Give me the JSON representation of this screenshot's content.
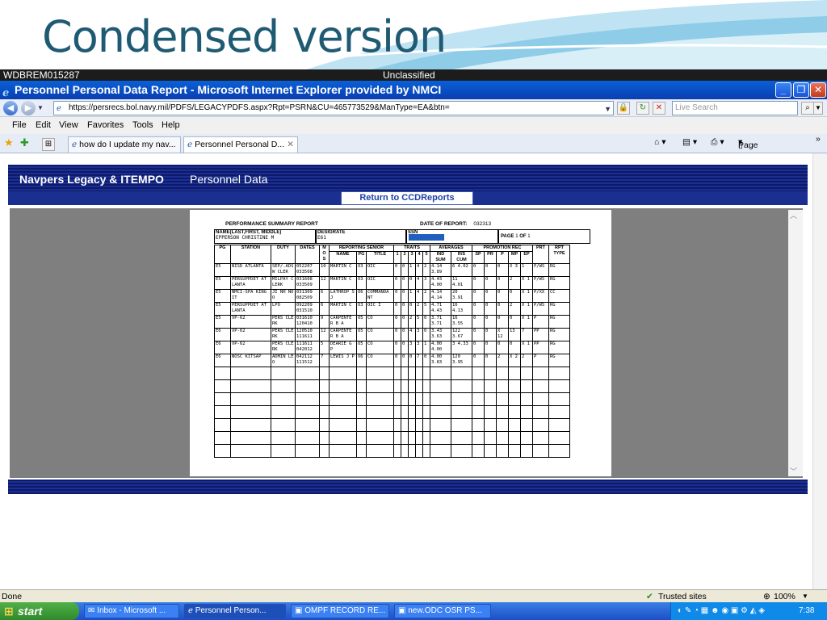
{
  "slide": {
    "title": "Condensed version"
  },
  "citrix": {
    "left": "WDBREM015287",
    "center": "Unclassified"
  },
  "window": {
    "title": "Personnel Personal Data Report - Microsoft Internet Explorer provided by NMCI"
  },
  "address": {
    "url": "https://persrecs.bol.navy.mil/PDFS/LEGACYPDFS.aspx?Rpt=PSRN&CU=465773529&ManType=EA&btn=",
    "search_placeholder": "Live Search"
  },
  "menu": [
    "File",
    "Edit",
    "View",
    "Favorites",
    "Tools",
    "Help"
  ],
  "tabs": [
    "how do I update my nav...",
    "Personnel Personal D..."
  ],
  "toolbar": {
    "page_label": "Page"
  },
  "portal": {
    "brand": "Navpers Legacy & ITEMPO",
    "section": "Personnel Data",
    "return_label": "Return to CCDReports"
  },
  "report": {
    "title": "PERFORMANCE SUMMARY REPORT",
    "date_label": "DATE OF REPORT:",
    "date_value": "032313",
    "name_label": "NAME(LAST,FIRST, MIDDLE)",
    "name_value": "EPPERSON CHRISTINE M",
    "desig_label": "DESIGRATE",
    "desig_value": "E61",
    "ssn_label": "SSN",
    "page_label": "PAGE",
    "page_num": "1",
    "of_label": "OF",
    "page_total": "1",
    "headers": {
      "pg": "PG",
      "station": "STATION",
      "duty": "DUTY",
      "dates": "DATES",
      "mos": "M O S",
      "reporting_senior": "REPORTING SENIOR",
      "rs_name": "NAME",
      "rs_pg": "PG",
      "rs_title": "TITLE",
      "traits": "TRAITS",
      "t1": "1",
      "t2": "2",
      "t3": "3",
      "t4": "4",
      "t5": "5",
      "averages": "AVERAGES",
      "ind_sum": "IND SUM",
      "rs_cum": "R/S CUM",
      "promotion_rec": "PROMOTION REC",
      "sp": "SP",
      "pr": "PR",
      "p": "P",
      "mp": "MP",
      "ep": "EP",
      "prt": "PRT",
      "rpt_type": "RPT TYPE"
    },
    "rows": [
      {
        "pg": "E5",
        "station": "NISD ATLANTA",
        "duty": "SEP/.ADS W CLER",
        "dates": "052207 033508",
        "mos": "10",
        "rs_name": "MARTIN C",
        "rs_pg": "O3",
        "rs_title": "OIC",
        "t1": "0",
        "t2": "0",
        "t3": "1",
        "t4": "4",
        "t5": "2",
        "ind": "4.14 3.89",
        "cum": "6 4.02",
        "sp": "0",
        "pr": "0",
        "p": "0",
        "mp": "X 3",
        "ep": "1",
        "prt": "P/WS",
        "type": "RG"
      },
      {
        "pg": "E5",
        "station": "PERSUPPDET AT LANTA",
        "duty": "MILPAY C LERK",
        "dates": "031608 033509",
        "mos": "12",
        "rs_name": "MARTIN C",
        "rs_pg": "O3",
        "rs_title": "OIC",
        "t1": "0",
        "t2": "0",
        "t3": "0",
        "t4": "4",
        "t5": "3",
        "ind": "4.43 4.00",
        "cum": "11 4.01",
        "sp": "0",
        "pr": "0",
        "p": "0",
        "mp": "2",
        "ep": "X 1",
        "prt": "P/WS",
        "type": "RG"
      },
      {
        "pg": "E5",
        "station": "NMCI-SPA KING IT",
        "duty": "JI NH NO O",
        "dates": "031309 082509",
        "mos": "6",
        "rs_name": "LATHROP S J",
        "rs_pg": "O6",
        "rs_title": "COMMANDA NT",
        "t1": "0",
        "t2": "0",
        "t3": "1",
        "t4": "4",
        "t5": "2",
        "ind": "4.14 4.14",
        "cum": "20 3.91",
        "sp": "0",
        "pr": "0",
        "p": "0",
        "mp": "0",
        "ep": "X 1",
        "prt": "P/XX",
        "type": "CC"
      },
      {
        "pg": "E5",
        "station": "PERSUPPDET AT LANTA",
        "duty": "LPO",
        "dates": "092209 031510",
        "mos": "6",
        "rs_name": "MARTIN C",
        "rs_pg": "O3",
        "rs_title": "OIC I",
        "t1": "0",
        "t2": "0",
        "t3": "0",
        "t4": "2",
        "t5": "5",
        "ind": "4.71 4.43",
        "cum": "16 4.13",
        "sp": "0",
        "pr": "0",
        "p": "0",
        "mp": "2",
        "ep": "X 1",
        "prt": "P/WS",
        "type": "RG"
      },
      {
        "pg": "E5",
        "station": "VP-62",
        "duty": "PERS CLE RK",
        "dates": "031610 120410",
        "mos": "9",
        "rs_name": "CARPENTE R B A",
        "rs_pg": "O5",
        "rs_title": "CO",
        "t1": "0",
        "t2": "0",
        "t3": "2",
        "t4": "5",
        "t5": "0",
        "ind": "3.71 3.71",
        "cum": "16 3.55",
        "sp": "0",
        "pr": "0",
        "p": "0",
        "mp": "0",
        "ep": "X 1",
        "prt": "P",
        "type": "RG"
      },
      {
        "pg": "E6",
        "station": "VP-62",
        "duty": "PERS CLE RK",
        "dates": "120510 111611",
        "mos": "12",
        "rs_name": "CARPENTE R B A",
        "rs_pg": "O5",
        "rs_title": "CO",
        "t1": "0",
        "t2": "0",
        "t3": "4",
        "t4": "3",
        "t5": "0",
        "ind": "3.43 3.63",
        "cum": "122 3.67",
        "sp": "0",
        "pr": "0",
        "p": "X 12",
        "mp": "13",
        "ep": "7",
        "prt": "PP",
        "type": "RG"
      },
      {
        "pg": "E6",
        "station": "VP-62",
        "duty": "PERS CLE RK",
        "dates": "111611 042012",
        "mos": "5",
        "rs_name": "DEARIE G P",
        "rs_pg": "O5",
        "rs_title": "CO",
        "t1": "0",
        "t2": "0",
        "t3": "3",
        "t4": "3",
        "t5": "1",
        "ind": "4.00 4.00",
        "cum": "3 4.33",
        "sp": "0",
        "pr": "0",
        "p": "0",
        "mp": "0",
        "ep": "X 1",
        "prt": "PP",
        "type": "RG"
      },
      {
        "pg": "E6",
        "station": "NOSC KITSAP",
        "duty": "ADMIN LE O",
        "dates": "042112 111512",
        "mos": "7",
        "rs_name": "LEWIS J P",
        "rs_pg": "O6",
        "rs_title": "CO",
        "t1": "0",
        "t2": "0",
        "t3": "0",
        "t4": "7",
        "t5": "0",
        "ind": "4.00 3.83",
        "cum": "120 3.95",
        "sp": "0",
        "pr": "0",
        "p": "2",
        "mp": "X 2",
        "ep": "2",
        "prt": "P",
        "type": "RG"
      }
    ]
  },
  "status": {
    "left": "Done",
    "zone": "Trusted sites",
    "zoom": "100%"
  },
  "taskbar": {
    "start": "start",
    "tasks": [
      "Inbox - Microsoft ...",
      "Personnel Person...",
      "OMPF RECORD RE...",
      "new.ODC OSR PS..."
    ],
    "time": "7:38"
  },
  "colors": {
    "title_teal": "#1f5a73",
    "ie_blue": "#0a4fd0",
    "navy": "#1a2f8f",
    "taskbar_blue": "#2a63d8",
    "start_green": "#3c9a36"
  }
}
